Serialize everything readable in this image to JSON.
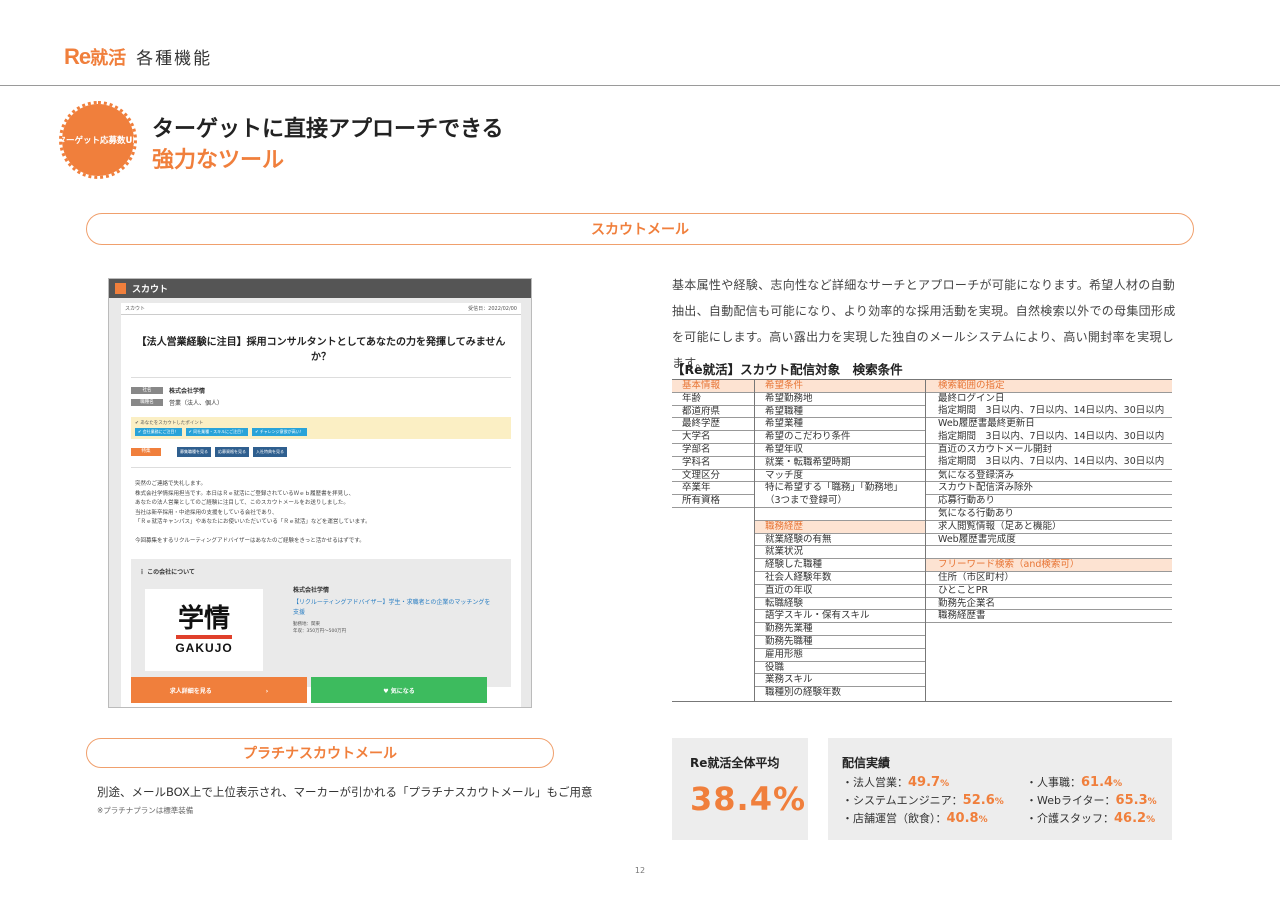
{
  "header": {
    "logo_re": "Re",
    "logo_shukatsu": "就活",
    "section": "各種機能"
  },
  "hero": {
    "badge": "ターゲット応募数UP",
    "line1": "ターゲットに直接アプローチできる",
    "line2": "強力なツール"
  },
  "scout_mail": {
    "label": "スカウトメール",
    "description": "基本属性や経験、志向性など詳細なサーチとアプローチが可能になります。希望人材の自動抽出、自動配信も可能になり、より効率的な採用活動を実現。自然検索以外での母集団形成を可能にします。高い露出力を実現した独自のメールシステムにより、高い開封率を実現します。",
    "table_title": "【Re就活】スカウト配信対象　検索条件",
    "col1": [
      "基本情報",
      "年齢",
      "都道府県",
      "最終学歴",
      "大学名",
      "学部名",
      "学科名",
      "文理区分",
      "卒業年",
      "所有資格"
    ],
    "col2_top": [
      "希望条件",
      "希望勤務地",
      "希望職種",
      "希望業種",
      "希望のこだわり条件",
      "希望年収",
      "就業・転職希望時期",
      "マッチ度"
    ],
    "col2_multi": "特に希望する「職務」「勤務地」\n（3つまで登録可）",
    "col2_bottom_header": "職務経歴",
    "col2_bottom": [
      "就業経験の有無",
      "就業状況",
      "経験した職種",
      "社会人経験年数",
      "直近の年収",
      "転職経験",
      "語学スキル・保有スキル",
      "勤務先業種",
      "勤務先職種",
      "雇用形態",
      "役職",
      "業務スキル",
      "職種別の経験年数"
    ],
    "col3_header": "検索範囲の指定",
    "col3_doubles": [
      "最終ログイン日\n指定期間　3日以内、7日以内、14日以内、30日以内",
      "Web履歴書最終更新日\n指定期間　3日以内、7日以内、14日以内、30日以内",
      "直近のスカウトメール開封\n指定期間　3日以内、7日以内、14日以内、30日以内"
    ],
    "col3_mid": [
      "気になる登録済み",
      "スカウト配信済み除外",
      "応募行動あり",
      "気になる行動あり",
      "求人閲覧情報（足あと機能）",
      "Web履歴書完成度"
    ],
    "col3_free_header": "フリーワード検索（and検索可）",
    "col3_free": [
      "住所（市区町村）",
      "ひとことPR",
      "勤務先企業名",
      "職務経歴書"
    ]
  },
  "mock": {
    "bar_title": "スカウト",
    "header_left": "スカウト",
    "header_right": "受信日：2022/02/00",
    "mail_title": "【法人営業経験に注目】採用コンサルタントとしてあなたの力を発揮してみませんか？",
    "label_company": "社名",
    "company": "株式会社学情",
    "label_job": "職種名",
    "job": "営業（法人、個人）",
    "point_title": "✔ あなたをスカウトしたポイント",
    "tags": [
      "✔ 会社業務にご注目！",
      "✔ 同社業種・スキルにご注目！",
      "✔ チャレンジ意欲が高い！"
    ],
    "label_req": "特集",
    "nav_buttons": [
      "募集職種を見る",
      "応募資格を見る",
      "入社特典を見る"
    ],
    "body": "突然のご連絡で失礼します。\n株式会社学情採用担当です。本日はＲｅ就活にご登録されているＷｅｂ履歴書を拝見し、\nあなたの法人営業としてのご経験に注目して、このスカウトメールをお送りしました。\n当社は新卒採用・中途採用の支援をしている会社であり、\n「Ｒｅ就活キャンパス」やあなたにお使いいただいている「Ｒｅ就活」などを運営しています。\n\n今回募集をするリクルーティングアドバイザーはあなたのご経験をきっと活かせるはずです。",
    "about": "ｉ この会社について",
    "logo_kanji": "学情",
    "logo_en": "GAKUJO",
    "card_company": "株式会社学情",
    "card_link": "【リクルーティングアドバイザー】学生・求職者との企業のマッチングを支援",
    "card_loc": "勤務地：関東",
    "card_salary": "年収：350万円〜500万円",
    "btn_detail": "求人詳細を見る　　　　　　　　　›",
    "btn_fav": "♥ 気になる"
  },
  "platinum": {
    "label": "プラチナスカウトメール",
    "text": "別途、メールBOX上で上位表示され、マーカーが引かれる「プラチナスカウトメール」もご用意",
    "note": "※プラチナプランは標準装備"
  },
  "stats": {
    "avg_title": "Re就活全体平均",
    "avg_value": "38.4%",
    "results_title": "配信実績",
    "results": [
      {
        "label": "・法人営業：",
        "value": "49.7",
        "unit": "%"
      },
      {
        "label": "・人事職：",
        "value": "61.4",
        "unit": "%"
      },
      {
        "label": "・システムエンジニア：",
        "value": "52.6",
        "unit": "%"
      },
      {
        "label": "・Webライター：",
        "value": "65.3",
        "unit": "%"
      },
      {
        "label": "・店舗運営（飲食）：",
        "value": "40.8",
        "unit": "%"
      },
      {
        "label": "・介護スタッフ：",
        "value": "46.2",
        "unit": "%"
      }
    ]
  },
  "page_number": "12",
  "colors": {
    "accent": "#f07f3c",
    "header_tint": "#fde3d2",
    "green": "#3dbb5e"
  }
}
